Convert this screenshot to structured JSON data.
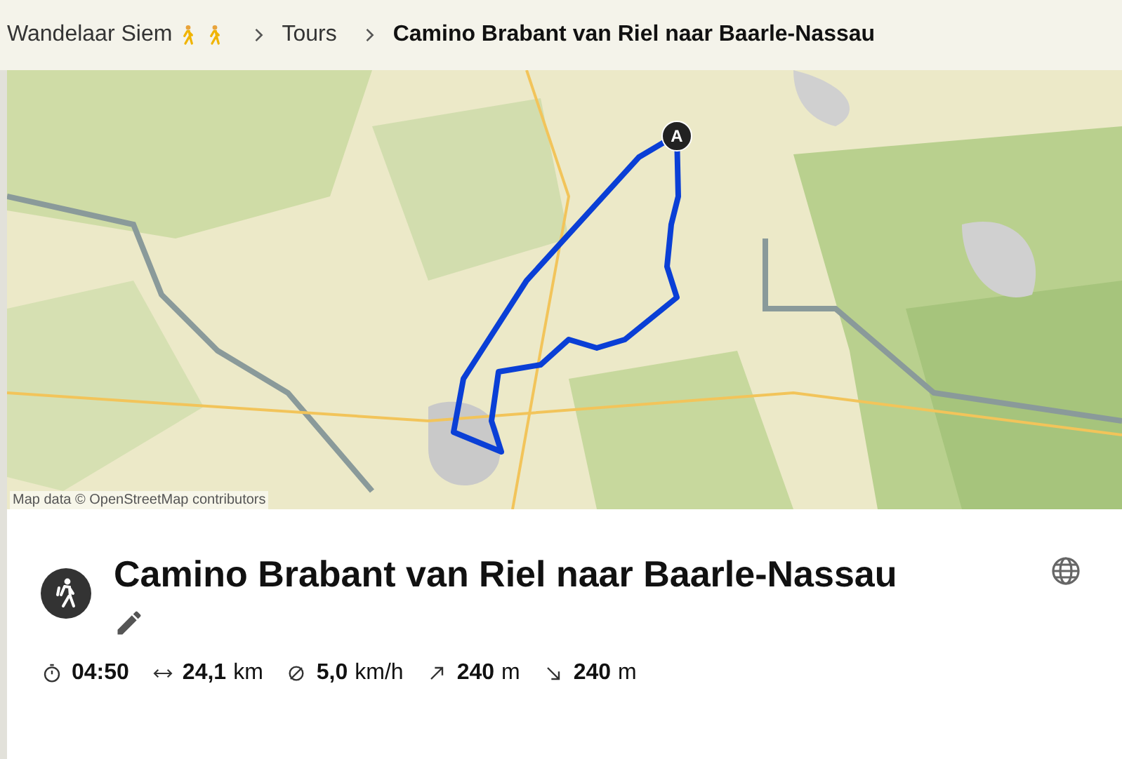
{
  "breadcrumb": [
    {
      "label": "Wandelaar Siem",
      "kind": "user",
      "current": false
    },
    {
      "label": "Tours",
      "kind": "page",
      "current": false
    },
    {
      "label": "Camino Brabant van Riel naar Baarle-Nassau",
      "kind": "page",
      "current": true
    }
  ],
  "map": {
    "kind": "picture",
    "start_marker": "A",
    "attribution": "Map data © OpenStreetMap contributors"
  },
  "tour": {
    "title": "Camino Brabant van Riel naar Baarle-Nassau",
    "stats": [
      {
        "kind": "duration",
        "value": "04:50"
      },
      {
        "kind": "distance",
        "value": "24,1",
        "unit": "km"
      },
      {
        "kind": "speed",
        "value": "5,0",
        "unit": "km/h"
      },
      {
        "kind": "ascent",
        "value": "240",
        "unit": "m"
      },
      {
        "kind": "descent",
        "value": "240",
        "unit": "m"
      }
    ]
  }
}
